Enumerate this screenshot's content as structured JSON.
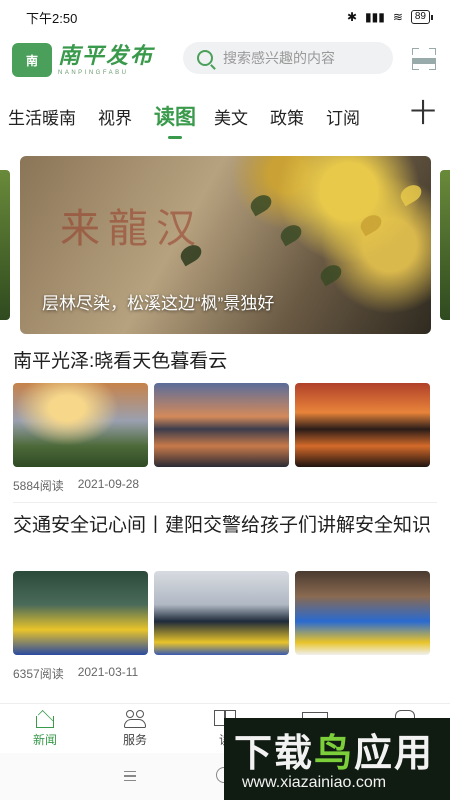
{
  "status_bar": {
    "time": "下午2:50",
    "bluetooth": "✱",
    "signal": "▮▮▮",
    "wifi": "≋",
    "battery": "89"
  },
  "header": {
    "logo_badge": "南",
    "logo_title": "南平发布",
    "logo_subtitle": "NANPINGFABU",
    "search_placeholder": "搜索感兴趣的内容"
  },
  "tabs": {
    "items": [
      "生活暖南",
      "视界",
      "读图",
      "美文",
      "政策",
      "订阅"
    ],
    "active_index": 2,
    "plus": "十"
  },
  "banner": {
    "caption": "层林尽染，松溪这边“枫”景独好",
    "overlay_chars": "来龍汉"
  },
  "news": [
    {
      "title": "南平光泽:晓看天色暮看云",
      "views": "5884阅读",
      "date": "2021-09-28"
    },
    {
      "title": "交通安全记心间丨建阳交警给孩子们讲解安全知识",
      "views": "6357阅读",
      "date": "2021-03-11"
    }
  ],
  "bottom_nav": {
    "items": [
      "新闻",
      "服务",
      "读",
      "",
      ""
    ],
    "active_index": 0
  },
  "watermark": {
    "title_part1": "下载",
    "title_part2": "鸟",
    "title_part3": "应用",
    "url": "www.xiazainiao.com"
  },
  "colors": {
    "brand_green": "#3a9a4c",
    "watermark_bg": "#101b12"
  }
}
